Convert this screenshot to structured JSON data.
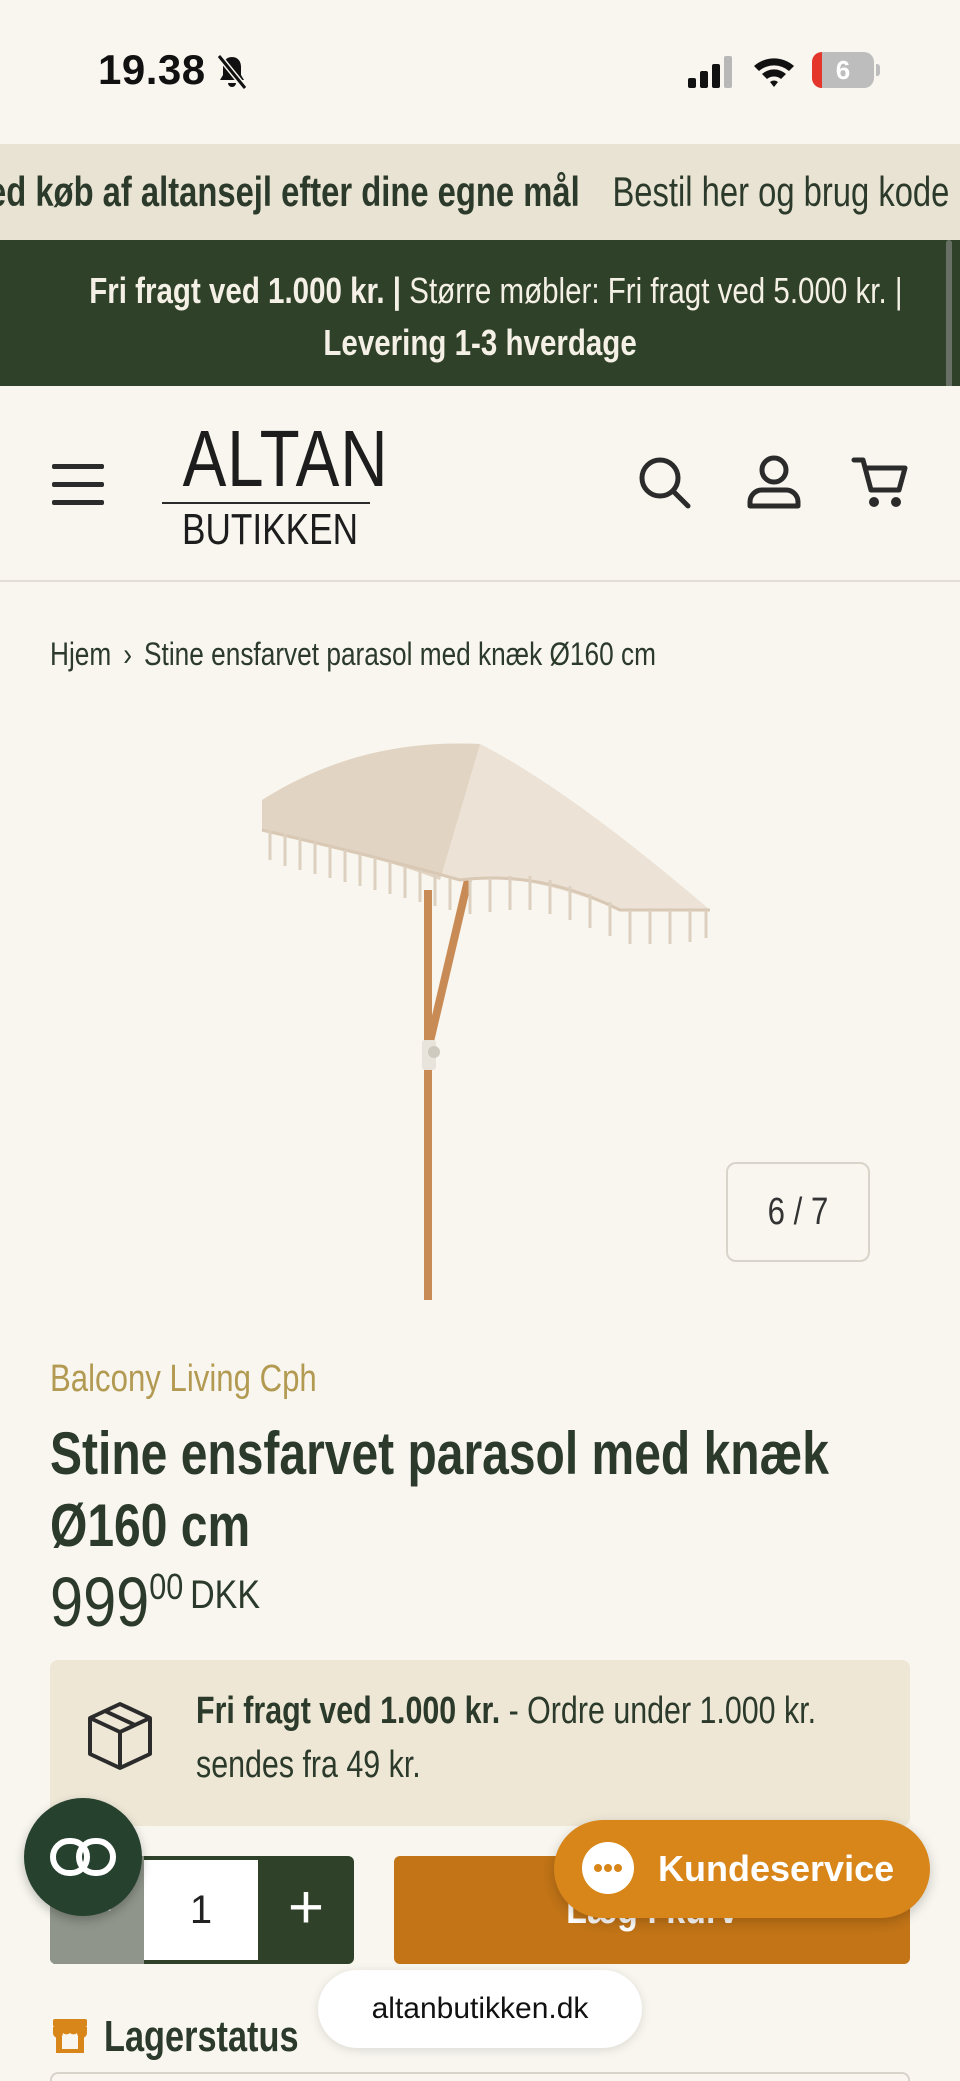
{
  "status_bar": {
    "time": "19.38",
    "battery": "6"
  },
  "marquee": {
    "text_1": "ed køb af altansejl efter dine egne mål",
    "text_2": "Bestil her og brug kode"
  },
  "shipping_bar": {
    "part_1": "Fri fragt ved 1.000 kr. |",
    "part_2": "Større møbler: Fri fragt ved 5.000 kr. |",
    "line_2": "Levering 1-3 hverdage"
  },
  "header": {
    "logo_top": "ALTAN",
    "logo_bottom": "BUTIKKEN",
    "icons": [
      "menu-icon",
      "search-icon",
      "account-icon",
      "cart-icon"
    ]
  },
  "breadcrumb": {
    "home": "Hjem",
    "current": "Stine ensfarvet parasol med knæk Ø160 cm"
  },
  "gallery": {
    "counter": "6 / 7"
  },
  "product": {
    "brand": "Balcony Living Cph",
    "title": "Stine ensfarvet parasol med knæk Ø160 cm",
    "price_main": "999",
    "price_decimals": "00",
    "currency": "DKK"
  },
  "shipping_info": {
    "bold": "Fri fragt ved 1.000 kr.",
    "rest": " - Ordre under 1.000 kr. sendes fra 49 kr."
  },
  "cart": {
    "minus": "−",
    "quantity": "1",
    "plus": "+",
    "add_label": "Læg i kurv"
  },
  "chat": {
    "label": "Kundeservice"
  },
  "stock": {
    "label": "Lagerstatus"
  },
  "browser": {
    "url": "altanbutikken.dk"
  },
  "colors": {
    "dark_green": "#2f4128",
    "accent_orange": "#c27417",
    "brand_gold": "#b39a52",
    "background": "#f8f6ef"
  }
}
